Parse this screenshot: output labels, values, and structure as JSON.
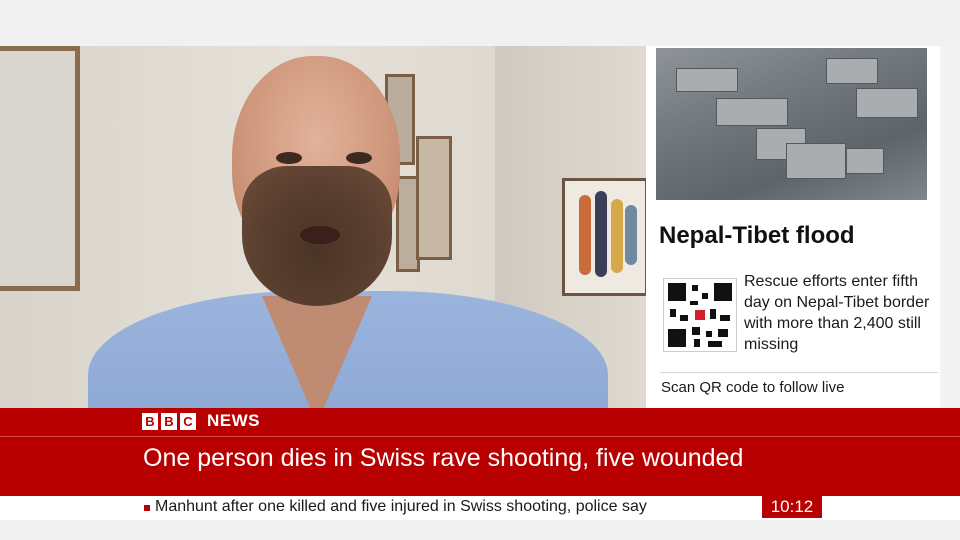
{
  "side_panel": {
    "title": "Nepal-Tibet flood",
    "description": "Rescue efforts enter fifth day on Nepal-Tibet border with more than 2,400 still missing",
    "scan_text": "Scan QR code to follow live"
  },
  "brand": {
    "logo_letters": [
      "B",
      "B",
      "C"
    ],
    "news_label": "NEWS"
  },
  "banner": {
    "headline": "One person dies in Swiss rave shooting, five wounded"
  },
  "ticker": {
    "text": "Manhunt after one killed and five injured in Swiss shooting, police say",
    "time": "10:12"
  },
  "colors": {
    "brand_red": "#b80000",
    "panel_bg": "#ffffff"
  }
}
